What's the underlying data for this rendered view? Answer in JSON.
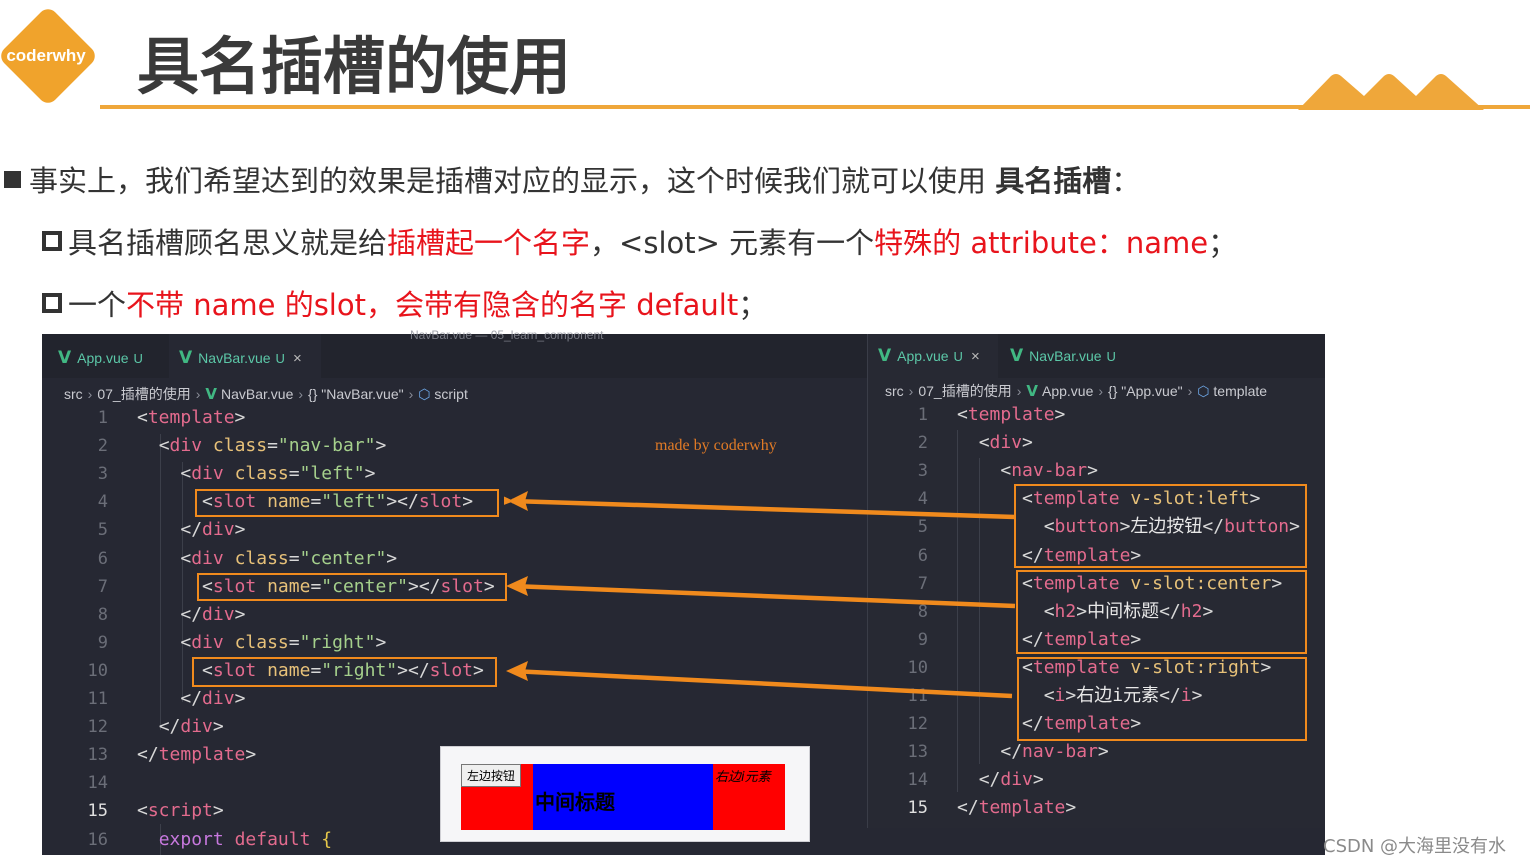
{
  "header": {
    "logo_text": "coderwhy",
    "title": "具名插槽的使用"
  },
  "bullets": {
    "b1": {
      "text": "事实上，我们希望达到的效果是插槽对应的显示，这个时候我们就可以使用 ",
      "bold": "具名插槽",
      "tail": "："
    },
    "b2": {
      "t1": "具名插槽顾名思义就是给",
      "r1": "插槽起一个名字",
      "t2": "，<slot> 元素有一个",
      "r2": "特殊的 attribute：name",
      "t3": "；"
    },
    "b3": {
      "t1": "一个",
      "r1": "不带 name 的slot，会带有隐含的名字 default",
      "t2": "；"
    }
  },
  "left_editor": {
    "window_title": "NavBar.vue — 05_learn_component",
    "tabs": [
      {
        "label": "App.vue",
        "status": "U",
        "closable": false
      },
      {
        "label": "NavBar.vue",
        "status": "U",
        "closable": true,
        "active": true
      }
    ],
    "close_glyph": "×",
    "breadcrumb": [
      "src",
      "07_插槽的使用",
      "NavBar.vue",
      "{} \"NavBar.vue\"",
      "script"
    ],
    "watermark": "made by coderwhy",
    "lines": [
      {
        "n": "1",
        "html": "<span class='pun'>&lt;</span><span class='tag'>template</span><span class='pun'>&gt;</span>"
      },
      {
        "n": "2",
        "html": "  <span class='pun'>&lt;</span><span class='tag'>div</span> <span class='attr'>class</span><span class='pun'>=</span><span class='str'>\"nav-bar\"</span><span class='pun'>&gt;</span>"
      },
      {
        "n": "3",
        "html": "    <span class='pun'>&lt;</span><span class='tag'>div</span> <span class='attr'>class</span><span class='pun'>=</span><span class='str'>\"left\"</span><span class='pun'>&gt;</span>"
      },
      {
        "n": "4",
        "html": "      <span class='pun'>&lt;</span><span class='tag'>slot</span> <span class='attr'>name</span><span class='pun'>=</span><span class='str'>\"left\"</span><span class='pun'>&gt;&lt;/</span><span class='tag'>slot</span><span class='pun'>&gt;</span>"
      },
      {
        "n": "5",
        "html": "    <span class='pun'>&lt;/</span><span class='tag'>div</span><span class='pun'>&gt;</span>"
      },
      {
        "n": "6",
        "html": "    <span class='pun'>&lt;</span><span class='tag'>div</span> <span class='attr'>class</span><span class='pun'>=</span><span class='str'>\"center\"</span><span class='pun'>&gt;</span>"
      },
      {
        "n": "7",
        "html": "      <span class='pun'>&lt;</span><span class='tag'>slot</span> <span class='attr'>name</span><span class='pun'>=</span><span class='str'>\"center\"</span><span class='pun'>&gt;&lt;/</span><span class='tag'>slot</span><span class='pun'>&gt;</span>"
      },
      {
        "n": "8",
        "html": "    <span class='pun'>&lt;/</span><span class='tag'>div</span><span class='pun'>&gt;</span>"
      },
      {
        "n": "9",
        "html": "    <span class='pun'>&lt;</span><span class='tag'>div</span> <span class='attr'>class</span><span class='pun'>=</span><span class='str'>\"right\"</span><span class='pun'>&gt;</span>"
      },
      {
        "n": "10",
        "html": "      <span class='pun'>&lt;</span><span class='tag'>slot</span> <span class='attr'>name</span><span class='pun'>=</span><span class='str'>\"right\"</span><span class='pun'>&gt;&lt;/</span><span class='tag'>slot</span><span class='pun'>&gt;</span>"
      },
      {
        "n": "11",
        "html": "    <span class='pun'>&lt;/</span><span class='tag'>div</span><span class='pun'>&gt;</span>"
      },
      {
        "n": "12",
        "html": "  <span class='pun'>&lt;/</span><span class='tag'>div</span><span class='pun'>&gt;</span>"
      },
      {
        "n": "13",
        "html": "<span class='pun'>&lt;/</span><span class='tag'>template</span><span class='pun'>&gt;</span>"
      },
      {
        "n": "14",
        "html": ""
      },
      {
        "n": "15",
        "html": "<span class='pun'>&lt;</span><span class='tag'>script</span><span class='pun'>&gt;</span>",
        "current": true
      },
      {
        "n": "16",
        "html": "  <span class='kw'>export</span> <span class='tag'>default</span> <span class='brace'>{</span>"
      }
    ]
  },
  "right_editor": {
    "tabs": [
      {
        "label": "App.vue",
        "status": "U",
        "closable": true,
        "active": true
      },
      {
        "label": "NavBar.vue",
        "status": "U",
        "closable": false
      }
    ],
    "close_glyph": "×",
    "breadcrumb": [
      "src",
      "07_插槽的使用",
      "App.vue",
      "{} \"App.vue\"",
      "template"
    ],
    "lines": [
      {
        "n": "1",
        "html": "<span class='pun'>&lt;</span><span class='tag'>template</span><span class='pun'>&gt;</span>"
      },
      {
        "n": "2",
        "html": "  <span class='pun'>&lt;</span><span class='tag'>div</span><span class='pun'>&gt;</span>"
      },
      {
        "n": "3",
        "html": "    <span class='pun'>&lt;</span><span class='tag'>nav-bar</span><span class='pun'>&gt;</span>"
      },
      {
        "n": "4",
        "html": "      <span class='pun'>&lt;</span><span class='tag'>template</span> <span class='attr'>v-slot:left</span><span class='pun'>&gt;</span>"
      },
      {
        "n": "5",
        "html": "        <span class='pun'>&lt;</span><span class='tag'>button</span><span class='pun'>&gt;</span><span class='txt'>左边按钮</span><span class='pun'>&lt;/</span><span class='tag'>button</span><span class='pun'>&gt;</span>"
      },
      {
        "n": "6",
        "html": "      <span class='pun'>&lt;/</span><span class='tag'>template</span><span class='pun'>&gt;</span>"
      },
      {
        "n": "7",
        "html": "      <span class='pun'>&lt;</span><span class='tag'>template</span> <span class='attr'>v-slot:center</span><span class='pun'>&gt;</span>"
      },
      {
        "n": "8",
        "html": "        <span class='pun'>&lt;</span><span class='tag'>h2</span><span class='pun'>&gt;</span><span class='txt'>中间标题</span><span class='pun'>&lt;/</span><span class='tag'>h2</span><span class='pun'>&gt;</span>"
      },
      {
        "n": "9",
        "html": "      <span class='pun'>&lt;/</span><span class='tag'>template</span><span class='pun'>&gt;</span>"
      },
      {
        "n": "10",
        "html": "      <span class='pun'>&lt;</span><span class='tag'>template</span> <span class='attr'>v-slot:right</span><span class='pun'>&gt;</span>"
      },
      {
        "n": "11",
        "html": "        <span class='pun'>&lt;</span><span class='tag'>i</span><span class='pun'>&gt;</span><span class='txt'>右边i元素</span><span class='pun'>&lt;/</span><span class='tag'>i</span><span class='pun'>&gt;</span>"
      },
      {
        "n": "12",
        "html": "      <span class='pun'>&lt;/</span><span class='tag'>template</span><span class='pun'>&gt;</span>"
      },
      {
        "n": "13",
        "html": "    <span class='pun'>&lt;/</span><span class='tag'>nav-bar</span><span class='pun'>&gt;</span>"
      },
      {
        "n": "14",
        "html": "  <span class='pun'>&lt;/</span><span class='tag'>div</span><span class='pun'>&gt;</span>"
      },
      {
        "n": "15",
        "html": "<span class='pun'>&lt;/</span><span class='tag'>template</span><span class='pun'>&gt;</span>",
        "current": true
      }
    ]
  },
  "preview": {
    "left_button": "左边按钮",
    "center_title": "中间标题",
    "right_italic": "右边i元素"
  },
  "colors": {
    "accent_orange": "#efa73a",
    "highlight_orange": "#f08a1d",
    "emphasis_red": "#e8141c",
    "editor_bg": "#262833",
    "vue_green": "#41b883"
  },
  "credit": "CSDN @大海里没有水"
}
